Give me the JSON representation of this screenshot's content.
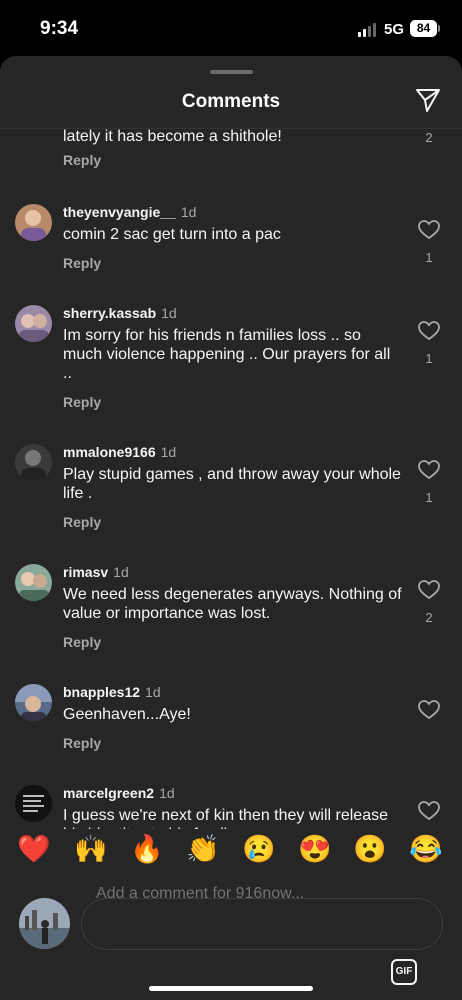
{
  "status_bar": {
    "time": "9:34",
    "network": "5G",
    "battery": "84"
  },
  "header": {
    "title": "Comments",
    "share_icon": "paper-plane-icon"
  },
  "comments": [
    {
      "username": "",
      "time": "",
      "text": "lately it has become a shithole!",
      "reply": "Reply",
      "likes": "2",
      "avatar_color": "#555"
    },
    {
      "username": "theyenvyangie__",
      "time": "1d",
      "text": "comin 2 sac get turn into a pac",
      "reply": "Reply",
      "likes": "1",
      "avatar_color": "#b98a6a"
    },
    {
      "username": "sherry.kassab",
      "time": "1d",
      "text": "Im sorry for his friends n families loss .. so much violence happening .. Our prayers for all ..",
      "reply": "Reply",
      "likes": "1",
      "avatar_color": "#9a8aa8"
    },
    {
      "username": "mmalone9166",
      "time": "1d",
      "text": "Play stupid games , and throw away your whole life .",
      "reply": "Reply",
      "likes": "1",
      "avatar_color": "#3a3a3a"
    },
    {
      "username": "rimasv",
      "time": "1d",
      "text": "We need less degenerates anyways. Nothing of value or importance was lost.",
      "reply": "Reply",
      "likes": "2",
      "avatar_color": "#8aa89a"
    },
    {
      "username": "bnapples12",
      "time": "1d",
      "text": "Geenhaven...Aye!",
      "reply": "Reply",
      "likes": "",
      "avatar_color": "#5a6a8a"
    },
    {
      "username": "marcelgreen2",
      "time": "1d",
      "text": "I guess we're next of kin then they will release his identity...to his family...",
      "reply": "",
      "likes": "",
      "avatar_color": "#111"
    }
  ],
  "reactions": [
    "❤️",
    "🙌",
    "🔥",
    "👏",
    "😢",
    "😍",
    "😮",
    "😂"
  ],
  "input": {
    "placeholder": "Add a comment for 916now...",
    "gif_label": "GIF"
  }
}
